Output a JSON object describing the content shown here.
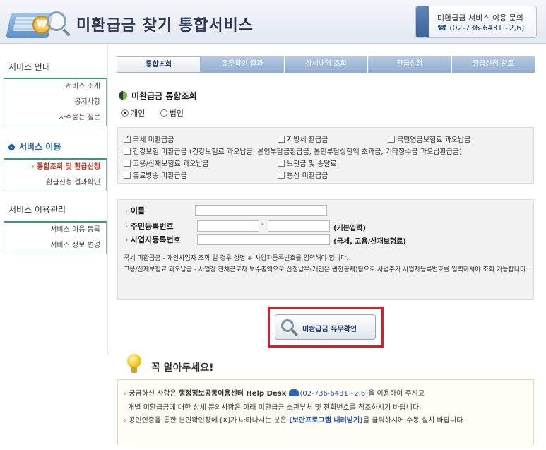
{
  "header": {
    "title": "미환급금 찾기 통합서비스",
    "contact_label": "미환급금 서비스 이용 문의",
    "contact_phone": "☎ (02-736-6431~2,6)"
  },
  "sidebar": {
    "sections": [
      {
        "heading": "서비스 안내",
        "items": [
          "서비스 소개",
          "공지사항",
          "자주묻는 질문"
        ]
      },
      {
        "heading": "서비스 이용",
        "items": [
          "통합조회 및 환급신청",
          "환급신청 결과확인"
        ]
      },
      {
        "heading": "서비스 이용관리",
        "items": [
          "서비스 이용 등록",
          "서비스 정보 변경"
        ]
      }
    ]
  },
  "steps": [
    "통합조회",
    "유무확인 결과",
    "상세내역 조회",
    "환급신청",
    "환급신청 완료"
  ],
  "section": {
    "title": "미환급금 통합조회",
    "radios": [
      "개인",
      "법인"
    ],
    "checkboxes": [
      "국세 미환급금",
      "지방세 환급금",
      "국민연금보험료 과오납금",
      "건강보험 미환급금 (건강보험료 과오납금, 본인부담금환급금, 본인부담상한액 초과금, 기타징수금 과오납환급금)",
      "고용/산재보험료 과오납금",
      "보관금 및 송달료",
      "유료방송 미환급금",
      "통신 미환급금"
    ]
  },
  "form": {
    "name_label": "이름",
    "rrn_label": "주민등록번호",
    "rrn_dash": "-",
    "rrn_note": "(기본입력)",
    "brn_label": "사업자등록번호",
    "brn_note": "(국세, 고용/산재보험료)",
    "help_line1": "국세 미환급금 - 개인사업자 조회 일 경우 성명 + 사업자등록번호를 입력해야 합니다.",
    "help_line2": "고용/산재보험료 과오납금 - 사업장 전체근로자 보수총액으로 산정납부(개인은 원천공제)됨으로 사업주가 사업자등록번호를 입력하셔야 조회 가능합니다."
  },
  "button": {
    "label": "미환급금 유무확인"
  },
  "notice": {
    "title": "꼭 알아두세요!",
    "line1_a": "궁금하신 사항은 ",
    "line1_b": "행정정보공동이용센터 Help Desk",
    "line1_c": "(02-736-6431~2,6)",
    "line1_d": "을 이용하여 주시고",
    "line2": "개별 미환급금에 대한 상세 문의사항은 아래 미환급금 소관부처 및 전화번호를 참조하시기 바랍니다.",
    "line3_a": "공인인증을 통한 본인확인창에 [X]가 나타나시는 분은 ",
    "line3_b": "[보안프로그램 내려받기]",
    "line3_c": "를 클릭하시어 수동 설치 바랍니다."
  }
}
